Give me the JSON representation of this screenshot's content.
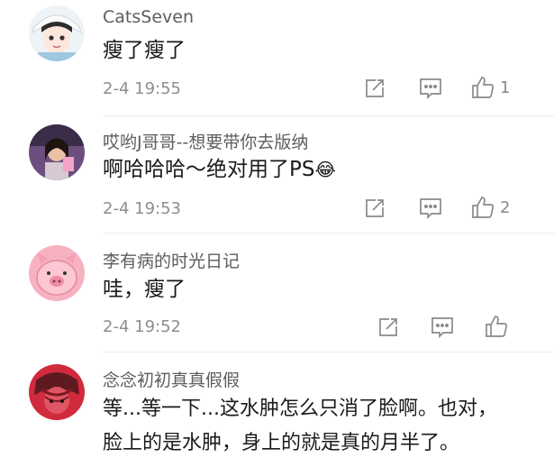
{
  "comments": [
    {
      "username": "CatsSeven",
      "content": "瘦了瘦了",
      "time": "2-4 19:55",
      "likes": "1"
    },
    {
      "username": "哎哟J哥哥--想要带你去版纳",
      "content": "啊哈哈哈～绝对用了PS",
      "emoji": "😂",
      "time": "2-4 19:53",
      "likes": "2"
    },
    {
      "username": "李有病的时光日记",
      "content": "哇，瘦了",
      "time": "2-4 19:52",
      "likes": ""
    },
    {
      "username": "念念初初真真假假",
      "content_lines": [
        "等...等一下...这水肿怎么只消了脸啊。也对，",
        "脸上的是水肿，身上的就是真的月半了。"
      ]
    }
  ],
  "icons": {
    "forward": "share-edit-icon",
    "reply": "comment-icon",
    "like": "thumbs-up-icon"
  },
  "colors": {
    "meta": "#8e8e8e",
    "username": "#5d5d5d",
    "text": "#1a1a1a"
  }
}
